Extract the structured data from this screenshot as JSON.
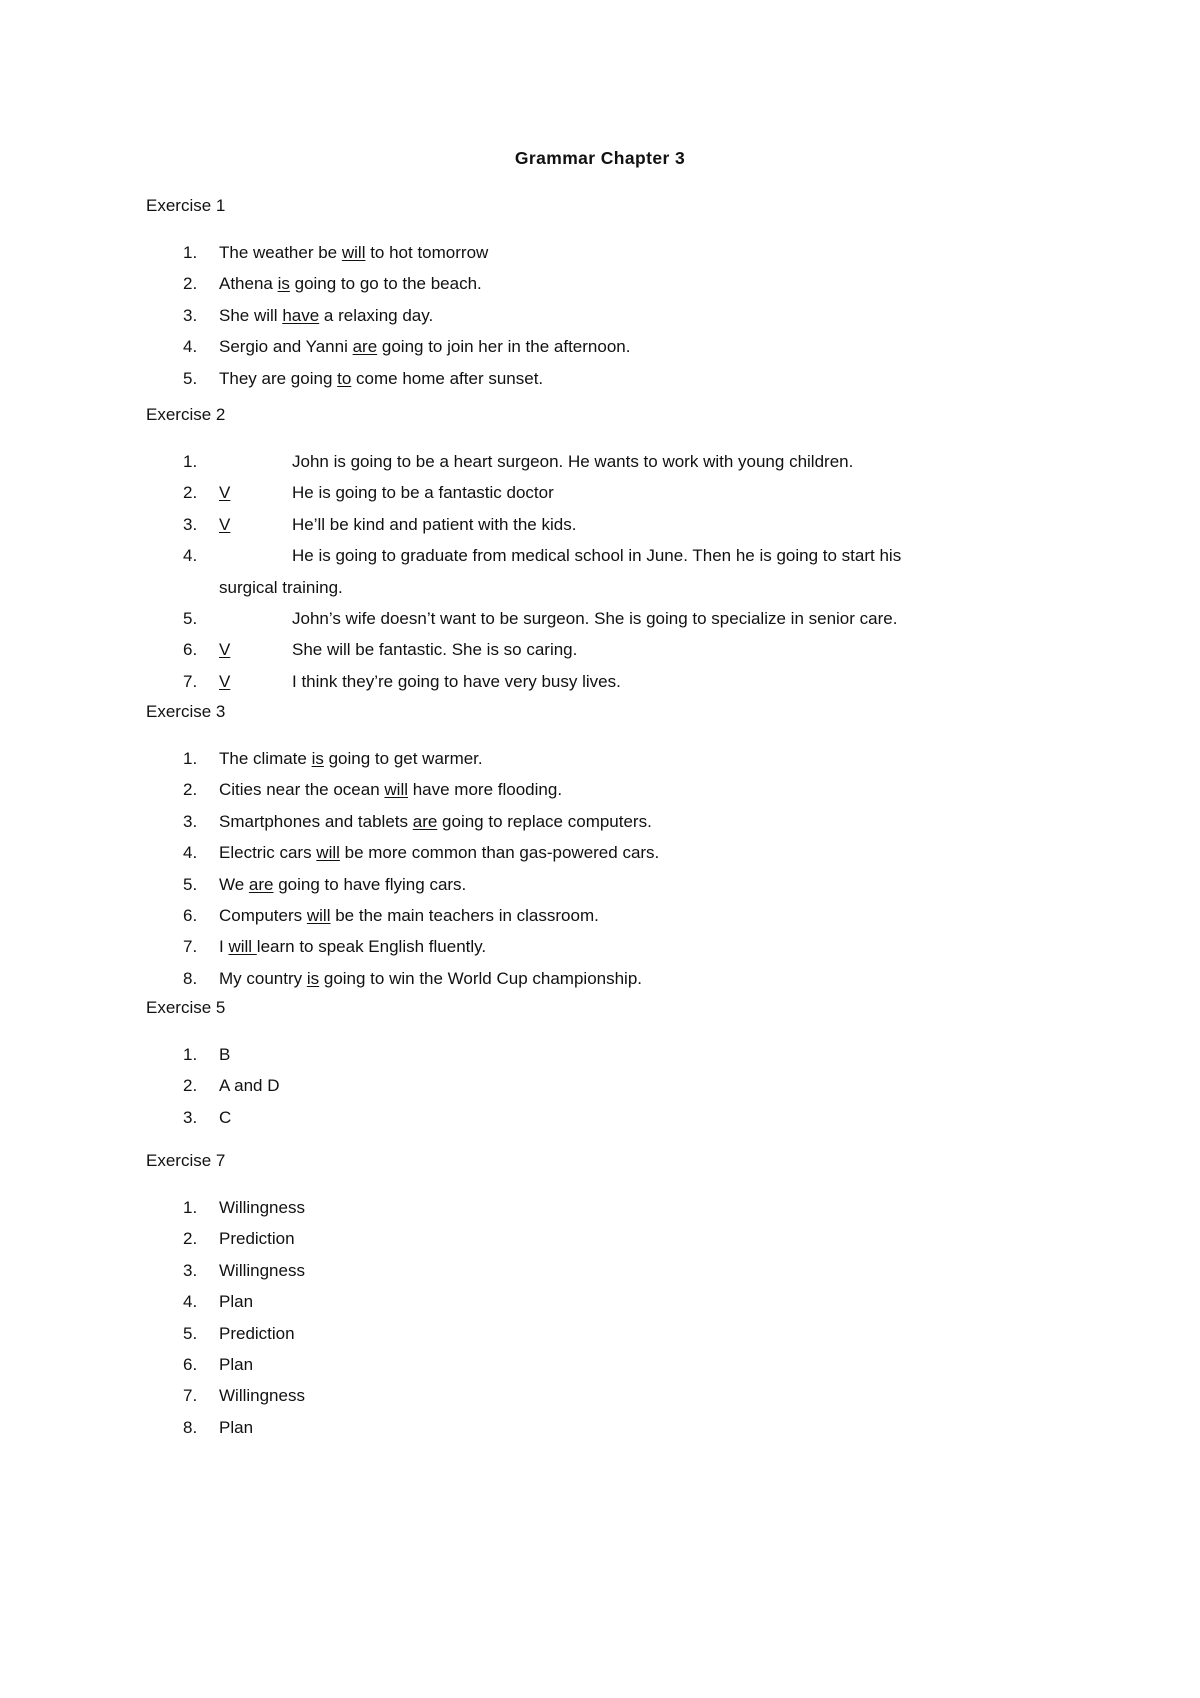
{
  "document": {
    "title": "Grammar Chapter 3",
    "exercises": [
      {
        "heading": "Exercise 1",
        "items": [
          {
            "num": "1.",
            "before": "The weather be ",
            "underlined": "will",
            "after": " to hot tomorrow"
          },
          {
            "num": "2.",
            "before": "Athena ",
            "underlined": "is",
            "after": " going to go to the beach."
          },
          {
            "num": "3.",
            "before": "She will ",
            "underlined": "have",
            "after": " a relaxing day."
          },
          {
            "num": "4.",
            "before": "Sergio and Yanni ",
            "underlined": "are",
            "after": " going to join her in the afternoon."
          },
          {
            "num": "5.",
            "before": "They are going ",
            "underlined": "to",
            "after": " come home after sunset."
          }
        ]
      },
      {
        "heading": "Exercise 2",
        "items": [
          {
            "num": "1.",
            "mark": "",
            "text": "John is going to be a heart surgeon. He wants to work with young children."
          },
          {
            "num": "2.",
            "mark": "V",
            "text": "He is going to be a fantastic doctor"
          },
          {
            "num": "3.",
            "mark": "V",
            "text": "He’ll be kind and patient with the kids."
          },
          {
            "num": "4.",
            "mark": "",
            "text": "He is going to graduate from medical school in June. Then he is going to start his",
            "continuation": "surgical training."
          },
          {
            "num": "5.",
            "mark": "",
            "text": "John’s wife doesn’t want to be surgeon. She is going to specialize in senior care."
          },
          {
            "num": "6.",
            "mark": "V",
            "text": "She will be fantastic. She is so caring."
          },
          {
            "num": "7.",
            "mark": "V",
            "text": "I think they’re going to have very busy lives."
          }
        ]
      },
      {
        "heading": "Exercise 3",
        "items": [
          {
            "num": "1.",
            "before": "The climate ",
            "underlined": "is",
            "after": " going to get warmer."
          },
          {
            "num": "2.",
            "before": "Cities near the ocean ",
            "underlined": "will",
            "after": " have more flooding."
          },
          {
            "num": "3.",
            "before": "Smartphones and tablets ",
            "underlined": "are",
            "after": " going to replace computers."
          },
          {
            "num": "4.",
            "before": "Electric cars ",
            "underlined": "will",
            "after": " be more common than gas-powered cars."
          },
          {
            "num": "5.",
            "before": "We ",
            "underlined": "are",
            "after": " going to have flying cars."
          },
          {
            "num": "6.",
            "before": "Computers ",
            "underlined": "will",
            "after": " be the main teachers in classroom."
          },
          {
            "num": "7.",
            "before": "I ",
            "underlined": "will ",
            "after": "learn to speak English fluently."
          },
          {
            "num": "8.",
            "before": "My country ",
            "underlined": "is",
            "after": " going to win the World Cup championship."
          }
        ]
      },
      {
        "heading": "Exercise 5",
        "items": [
          {
            "num": "1.",
            "text": "B"
          },
          {
            "num": "2.",
            "text": "A and D"
          },
          {
            "num": "3.",
            "text": "C"
          }
        ]
      },
      {
        "heading": "Exercise 7",
        "items": [
          {
            "num": "1.",
            "text": "Willingness"
          },
          {
            "num": "2.",
            "text": "Prediction"
          },
          {
            "num": "3.",
            "text": "Willingness"
          },
          {
            "num": "4.",
            "text": "Plan"
          },
          {
            "num": "5.",
            "text": "Prediction"
          },
          {
            "num": "6.",
            "text": "Plan"
          },
          {
            "num": "7.",
            "text": "Willingness"
          },
          {
            "num": "8.",
            "text": "Plan"
          }
        ]
      }
    ]
  }
}
